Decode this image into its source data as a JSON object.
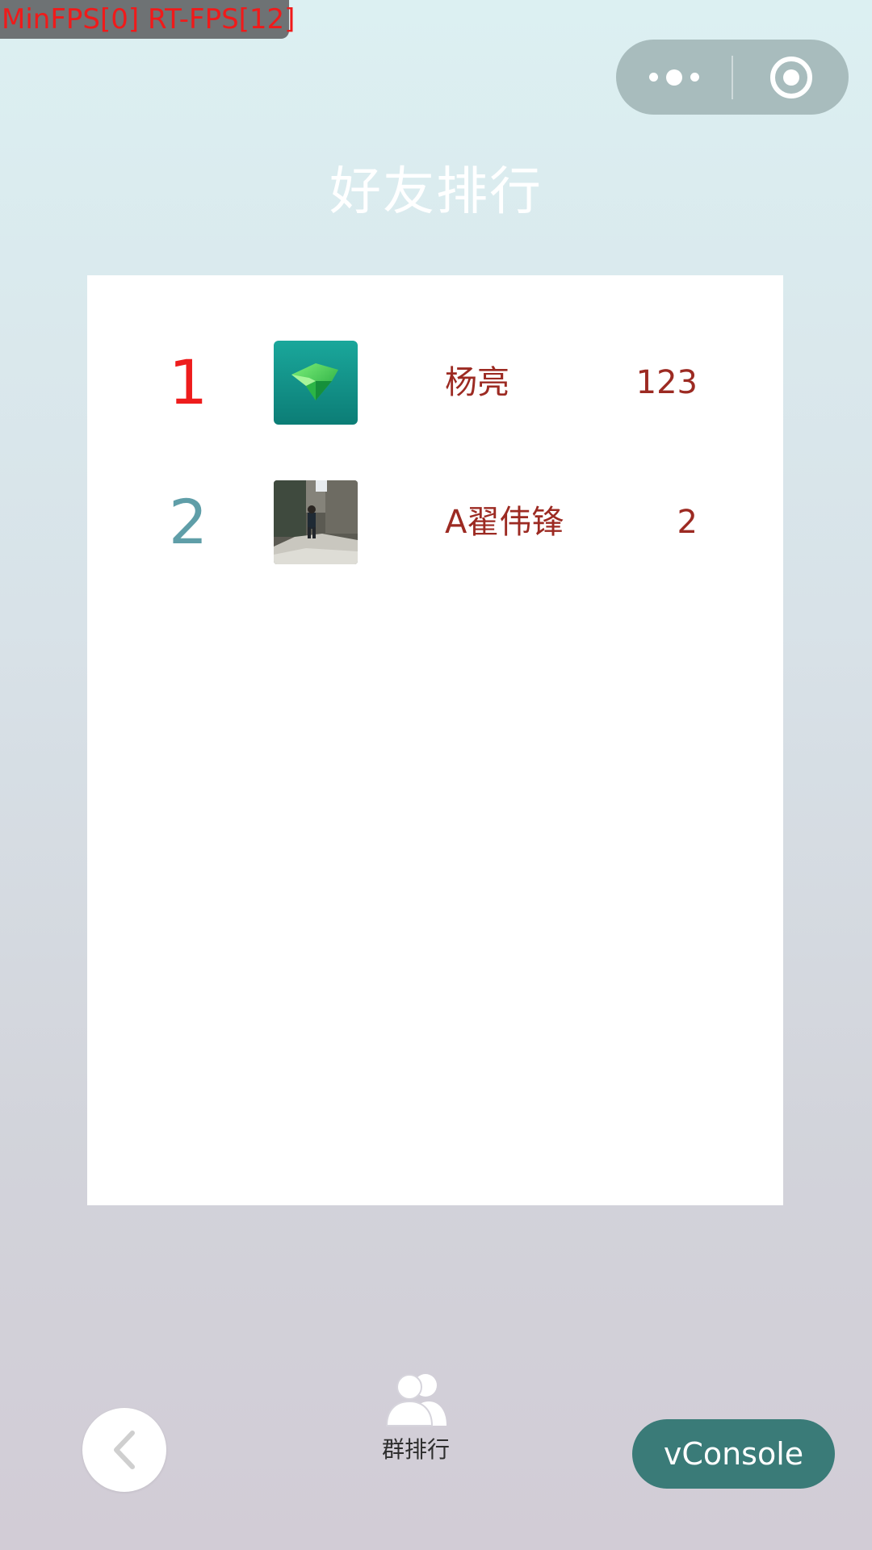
{
  "debug": {
    "fps_text": "MinFPS[0] RT-FPS[12]"
  },
  "menu_capsule": {
    "more_icon": "more-dots-icon",
    "close_icon": "target-circle-icon"
  },
  "title": "好友排行",
  "leaderboard": {
    "rows": [
      {
        "rank": "1",
        "name": "杨亮",
        "score": "123",
        "avatar": "green-diamond-icon",
        "rank_color": "#ee1c1c"
      },
      {
        "rank": "2",
        "name": "A翟伟锋",
        "score": "2",
        "avatar": "photo-person-on-rock",
        "rank_color": "#5f9ea8"
      }
    ]
  },
  "bottom": {
    "back_icon": "chevron-left-icon",
    "group_rank_icon": "group-users-icon",
    "group_rank_label": "群排行",
    "vconsole_label": "vConsole"
  },
  "colors": {
    "name_text": "#9c2a22",
    "vconsole_bg": "#3a7b78"
  }
}
